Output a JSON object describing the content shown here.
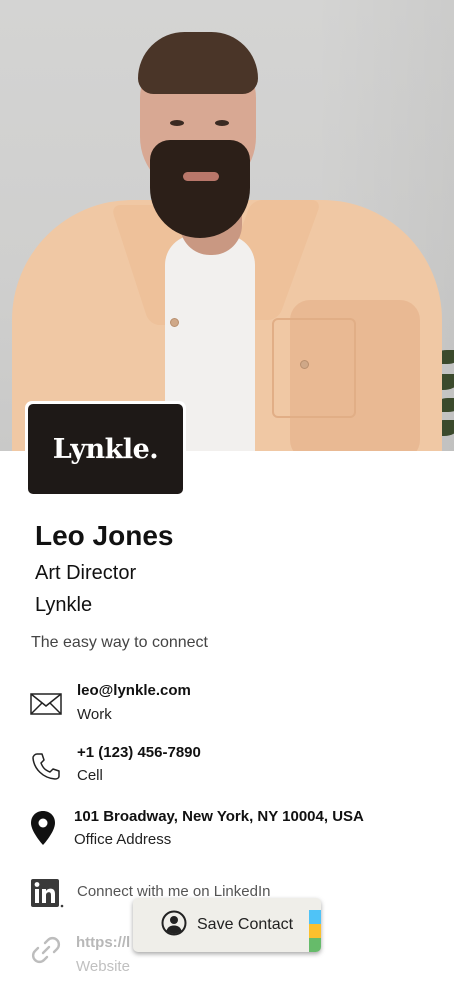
{
  "profile": {
    "name": "Leo Jones",
    "job_title": "Art Director",
    "company": "Lynkle",
    "headline": "The easy way to connect",
    "logo_text": "Lynkle."
  },
  "contacts": {
    "email": {
      "value": "leo@lynkle.com",
      "label": "Work",
      "icon": "envelope-icon"
    },
    "phone": {
      "value": "+1 (123) 456-7890",
      "label": "Cell",
      "icon": "phone-icon"
    },
    "address": {
      "value": "101 Broadway, New York, NY 10004, USA",
      "label": "Office Address",
      "icon": "map-pin-icon"
    },
    "linkedin": {
      "value": "Connect with me on LinkedIn",
      "icon": "linkedin-icon"
    },
    "website": {
      "value": "https://l",
      "label": "Website",
      "icon": "link-icon"
    }
  },
  "save_button": {
    "label": "Save Contact",
    "icon": "user-circle-icon"
  },
  "colors": {
    "logo_background": "#1e1917",
    "text_primary": "#111111",
    "button_background": "#efeee9",
    "stripe": [
      "#4fc3f7",
      "#fbc02d",
      "#66bb6a"
    ]
  }
}
